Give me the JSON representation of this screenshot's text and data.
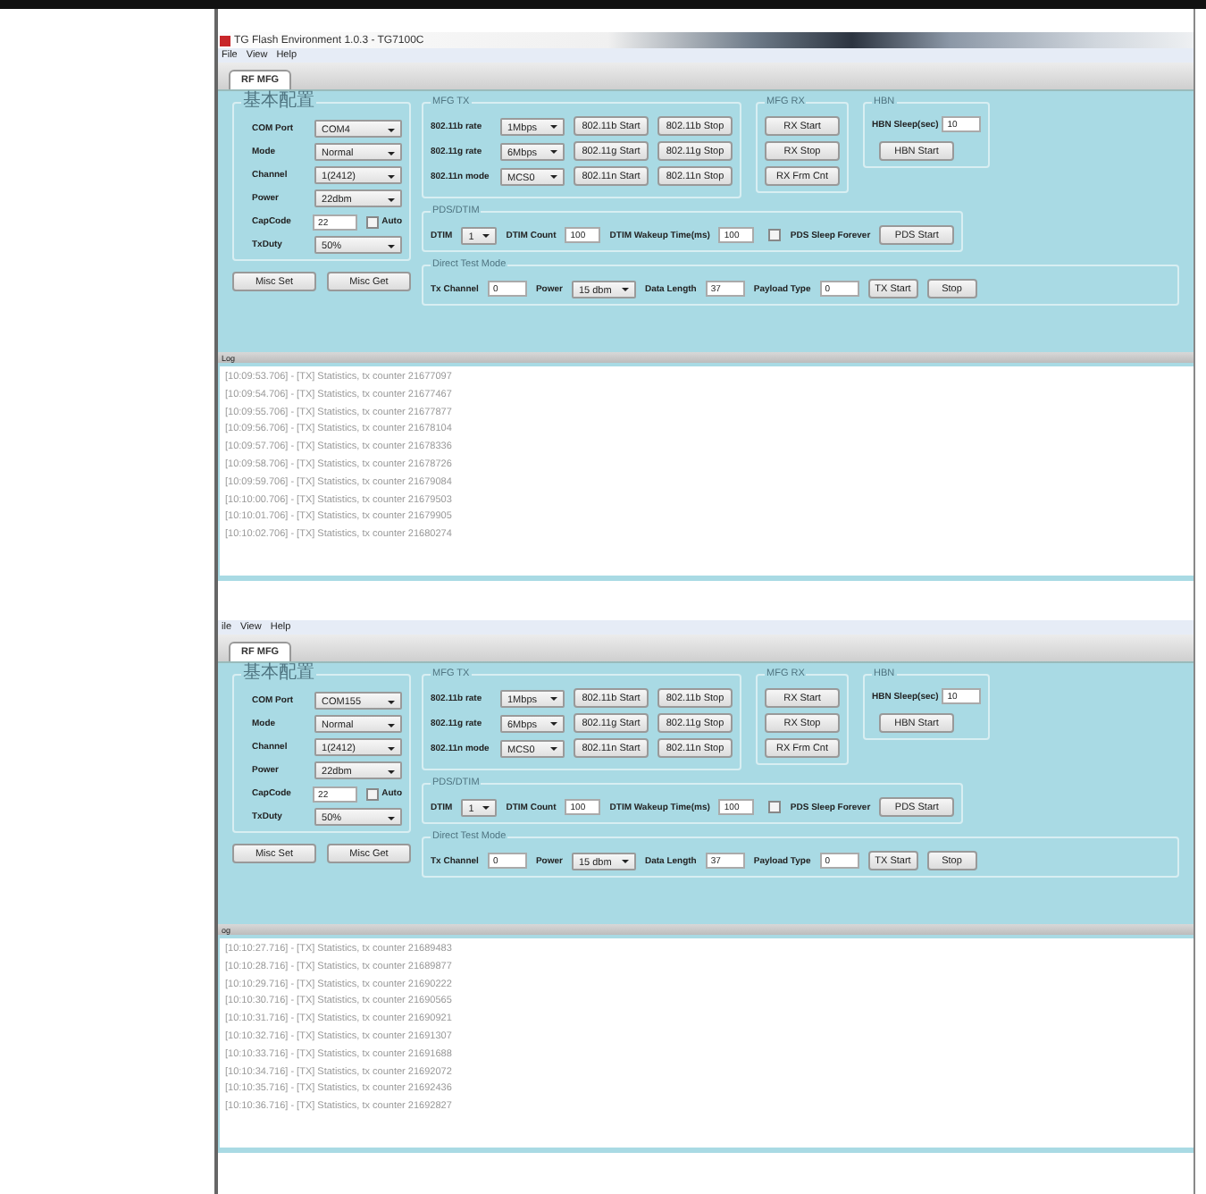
{
  "windows": [
    {
      "title": "TG Flash Environment 1.0.3 - TG7100C",
      "menu": [
        "File",
        "View",
        "Help"
      ],
      "tabs": [
        {
          "label": "RF MFG",
          "selected": true
        }
      ],
      "basic": {
        "title": "基本配置",
        "rows": [
          {
            "kind": "select",
            "label": "COM Port",
            "value": "COM4"
          },
          {
            "kind": "select",
            "label": "Mode",
            "value": "Normal"
          },
          {
            "kind": "select",
            "label": "Channel",
            "value": "1(2412)"
          },
          {
            "kind": "select",
            "label": "Power",
            "value": "22dbm"
          },
          {
            "kind": "input",
            "label": "CapCode",
            "value": "22",
            "check_label": "Auto",
            "checked": false
          },
          {
            "kind": "select",
            "label": "TxDuty",
            "value": "50%"
          }
        ],
        "buttons": [
          "Misc Set",
          "Misc Get"
        ]
      },
      "mfg_tx": {
        "title": "MFG TX",
        "rows": [
          {
            "label": "802.11b rate",
            "value": "1Mbps",
            "start": "802.11b Start",
            "stop": "802.11b Stop"
          },
          {
            "label": "802.11g rate",
            "value": "6Mbps",
            "start": "802.11g Start",
            "stop": "802.11g Stop"
          },
          {
            "label": "802.11n mode",
            "value": "MCS0",
            "start": "802.11n Start",
            "stop": "802.11n Stop"
          }
        ]
      },
      "mfg_rx": {
        "title": "MFG RX",
        "buttons": [
          "RX Start",
          "RX Stop",
          "RX Frm Cnt"
        ]
      },
      "hbn": {
        "title": "HBN",
        "label": "HBN Sleep(sec)",
        "value": "10",
        "button": "HBN Start"
      },
      "pds": {
        "title": "PDS/DTIM",
        "dtim_label": "DTIM",
        "dtim_value": "1",
        "count_label": "DTIM Count",
        "count_value": "100",
        "wake_label": "DTIM Wakeup Time(ms)",
        "wake_value": "100",
        "check_label": "PDS Sleep Forever",
        "checked": false,
        "button": "PDS Start"
      },
      "dtm": {
        "title": "Direct Test Mode",
        "fields": [
          {
            "kind": "input",
            "label": "Tx Channel",
            "value": "0"
          },
          {
            "kind": "select",
            "label": "Power",
            "value": "15 dbm"
          },
          {
            "kind": "input",
            "label": "Data Length",
            "value": "37"
          },
          {
            "kind": "input",
            "label": "Payload Type",
            "value": "0"
          }
        ],
        "buttons": [
          "TX Start",
          "Stop"
        ]
      },
      "log": {
        "label": "Log",
        "lines": [
          "[10:09:53.706] - [TX] Statistics, tx counter 21677097",
          "[10:09:54.706] - [TX] Statistics, tx counter 21677467",
          "[10:09:55.706] - [TX] Statistics, tx counter 21677877",
          "[10:09:56.706] - [TX] Statistics, tx counter 21678104",
          "[10:09:57.706] - [TX] Statistics, tx counter 21678336",
          "[10:09:58.706] - [TX] Statistics, tx counter 21678726",
          "[10:09:59.706] - [TX] Statistics, tx counter 21679084",
          "[10:10:00.706] - [TX] Statistics, tx counter 21679503",
          "[10:10:01.706] - [TX] Statistics, tx counter 21679905",
          "[10:10:02.706] - [TX] Statistics, tx counter 21680274"
        ]
      }
    },
    {
      "menu": [
        "ile",
        "View",
        "Help"
      ],
      "tabs": [
        {
          "label": "RF MFG",
          "selected": true
        }
      ],
      "basic": {
        "title": "基本配置",
        "rows": [
          {
            "kind": "select",
            "label": "COM Port",
            "value": "COM155"
          },
          {
            "kind": "select",
            "label": "Mode",
            "value": "Normal"
          },
          {
            "kind": "select",
            "label": "Channel",
            "value": "1(2412)"
          },
          {
            "kind": "select",
            "label": "Power",
            "value": "22dbm"
          },
          {
            "kind": "input",
            "label": "CapCode",
            "value": "22",
            "check_label": "Auto",
            "checked": false
          },
          {
            "kind": "select",
            "label": "TxDuty",
            "value": "50%"
          }
        ],
        "buttons": [
          "Misc Set",
          "Misc Get"
        ]
      },
      "mfg_tx": {
        "title": "MFG TX",
        "rows": [
          {
            "label": "802.11b rate",
            "value": "1Mbps",
            "start": "802.11b Start",
            "stop": "802.11b Stop"
          },
          {
            "label": "802.11g rate",
            "value": "6Mbps",
            "start": "802.11g Start",
            "stop": "802.11g Stop"
          },
          {
            "label": "802.11n mode",
            "value": "MCS0",
            "start": "802.11n Start",
            "stop": "802.11n Stop"
          }
        ]
      },
      "mfg_rx": {
        "title": "MFG RX",
        "buttons": [
          "RX Start",
          "RX Stop",
          "RX Frm Cnt"
        ]
      },
      "hbn": {
        "title": "HBN",
        "label": "HBN Sleep(sec)",
        "value": "10",
        "button": "HBN Start"
      },
      "pds": {
        "title": "PDS/DTIM",
        "dtim_label": "DTIM",
        "dtim_value": "1",
        "count_label": "DTIM Count",
        "count_value": "100",
        "wake_label": "DTIM Wakeup Time(ms)",
        "wake_value": "100",
        "check_label": "PDS Sleep Forever",
        "checked": false,
        "button": "PDS Start"
      },
      "dtm": {
        "title": "Direct Test Mode",
        "fields": [
          {
            "kind": "input",
            "label": "Tx Channel",
            "value": "0"
          },
          {
            "kind": "select",
            "label": "Power",
            "value": "15 dbm"
          },
          {
            "kind": "input",
            "label": "Data Length",
            "value": "37"
          },
          {
            "kind": "input",
            "label": "Payload Type",
            "value": "0"
          }
        ],
        "buttons": [
          "TX Start",
          "Stop"
        ]
      },
      "log": {
        "label": "og",
        "lines": [
          "[10:10:27.716] - [TX] Statistics, tx counter 21689483",
          "[10:10:28.716] - [TX] Statistics, tx counter 21689877",
          "[10:10:29.716] - [TX] Statistics, tx counter 21690222",
          "[10:10:30.716] - [TX] Statistics, tx counter 21690565",
          "[10:10:31.716] - [TX] Statistics, tx counter 21690921",
          "[10:10:32.716] - [TX] Statistics, tx counter 21691307",
          "[10:10:33.716] - [TX] Statistics, tx counter 21691688",
          "[10:10:34.716] - [TX] Statistics, tx counter 21692072",
          "[10:10:35.716] - [TX] Statistics, tx counter 21692436",
          "[10:10:36.716] - [TX] Statistics, tx counter 21692827"
        ]
      }
    }
  ]
}
